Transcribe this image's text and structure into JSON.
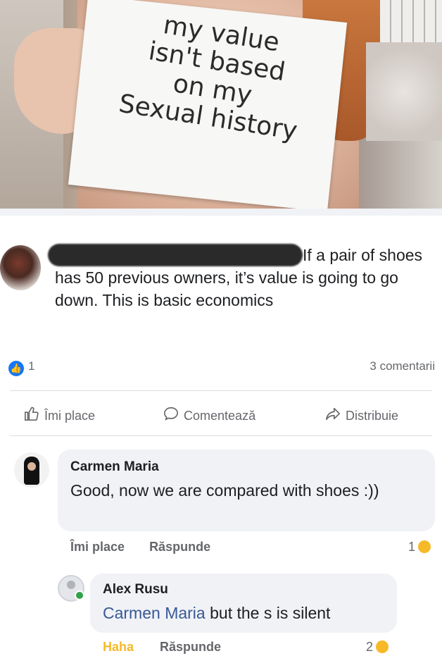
{
  "photo": {
    "sign_lines": [
      "my value",
      "isn't based",
      "on my",
      "Sexual history"
    ]
  },
  "post": {
    "text": "If a pair of shoes has 50 previous owners, it’s value is going to go down. This is basic economics",
    "like_count": "1",
    "comments_count": "3 comentarii"
  },
  "actions": {
    "like": "Îmi place",
    "comment": "Comentează",
    "share": "Distribuie"
  },
  "comments": [
    {
      "author": "Carmen Maria",
      "text": "Good, now we are compared with shoes :))",
      "like_label": "Îmi place",
      "reply_label": "Răspunde",
      "reaction_count": "1"
    }
  ],
  "reply": {
    "author": "Alex Rusu",
    "mention": "Carmen Maria",
    "text": " but the s is silent",
    "reaction_label": "Haha",
    "reply_label": "Răspunde",
    "reaction_count": "2"
  },
  "colors": {
    "facebook_blue": "#1877f2",
    "mention": "#385898",
    "haha": "#f7b928",
    "secondary_text": "#65676b",
    "bubble_bg": "#f0f2f5"
  }
}
